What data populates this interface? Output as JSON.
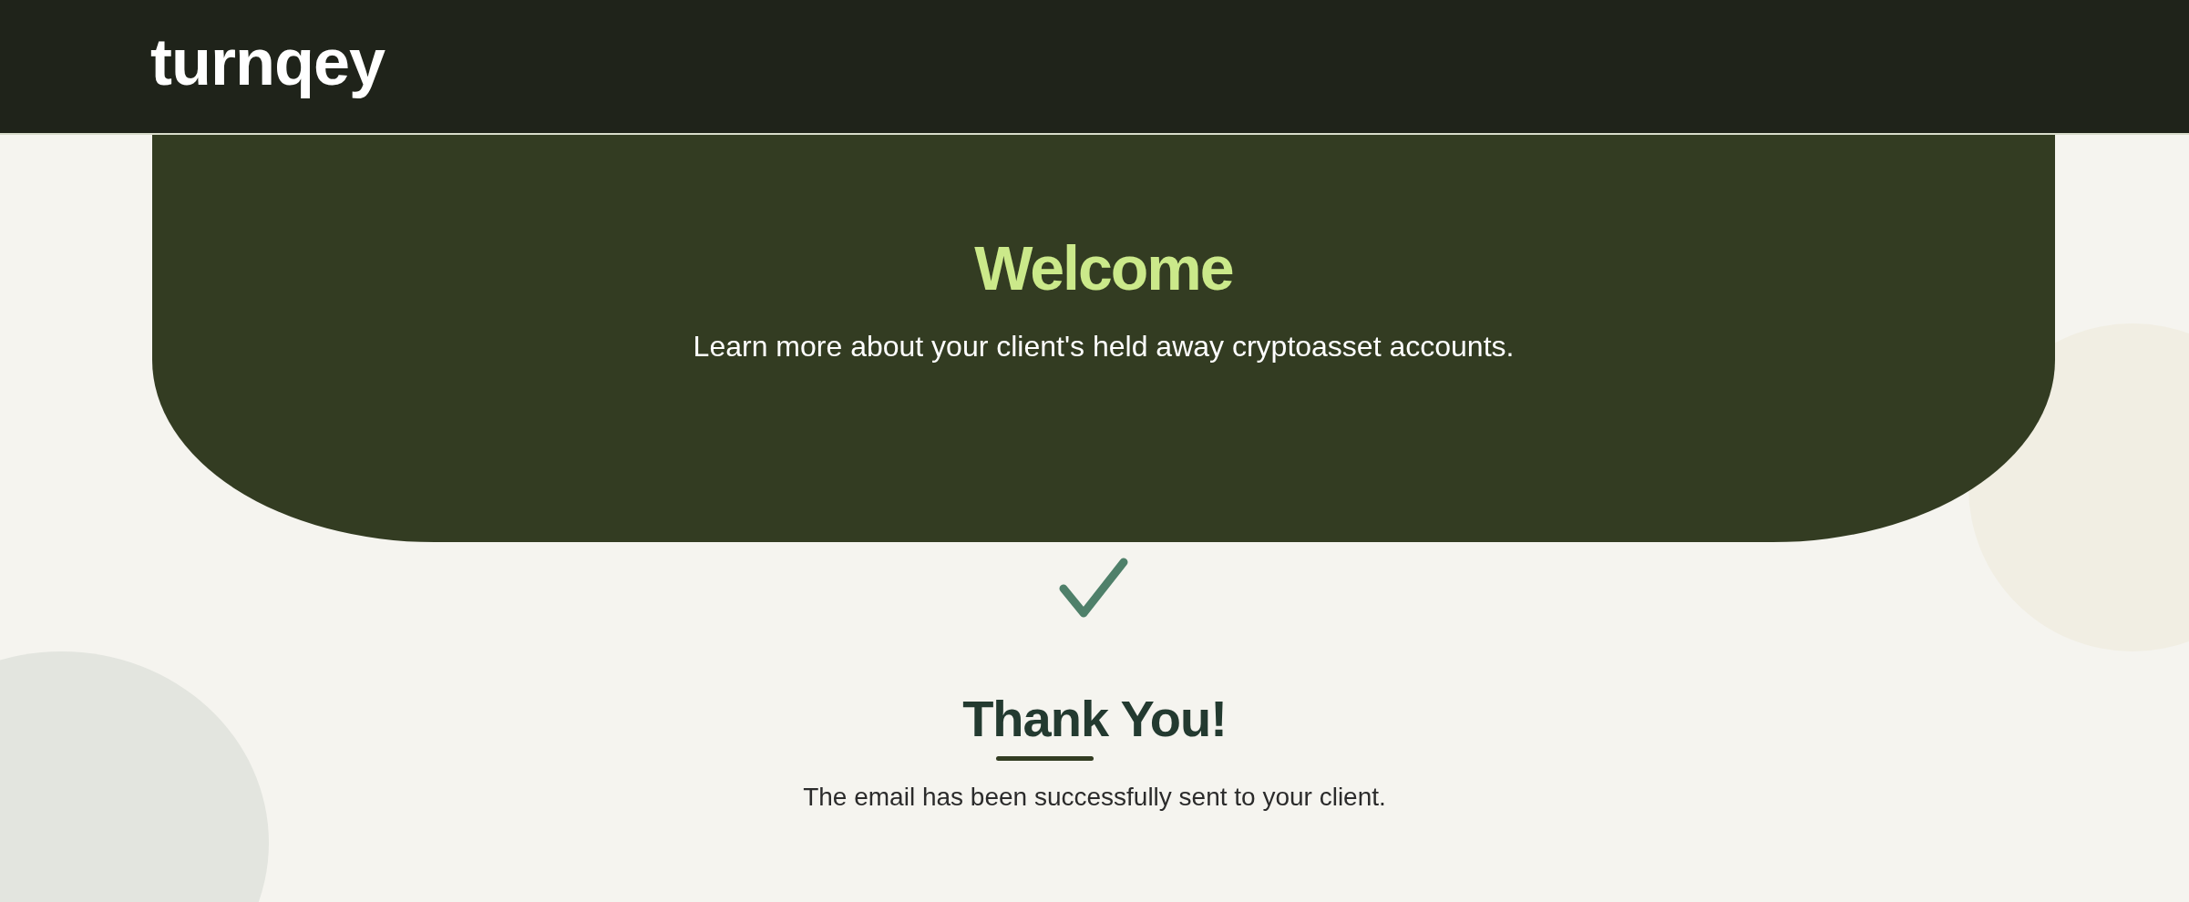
{
  "header": {
    "logo": "turnqey"
  },
  "hero": {
    "title": "Welcome",
    "subtitle": "Learn more about your client's held away cryptoasset accounts."
  },
  "confirmation": {
    "title": "Thank You!",
    "message": "The email has been successfully sent to your client."
  }
}
